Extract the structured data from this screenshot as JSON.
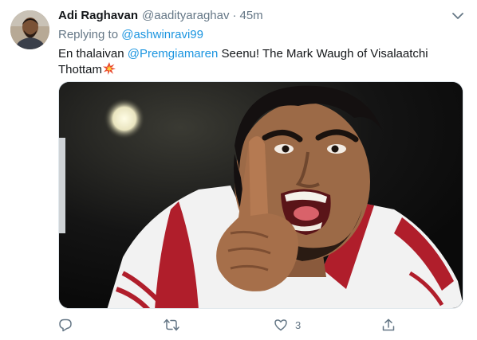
{
  "tweet": {
    "author_name": "Adi Raghavan",
    "author_handle": "@aadityaraghav",
    "separator": "·",
    "time": "45m",
    "replying_prefix": "Replying to ",
    "replying_handle": "@ashwinravi99",
    "text_part1": "En thalaivan ",
    "text_mention": "@Premgiamaren",
    "text_part2": " Seenu! The Mark Waugh of Visalaatchi Thottam",
    "emoji": "collision-emoji"
  },
  "actions": {
    "reply_count": "",
    "retweet_count": "",
    "like_count": "3",
    "share_count": ""
  },
  "colors": {
    "link": "#1b95e0",
    "secondary_text": "#657786",
    "primary_text": "#14171a",
    "border": "#e1e8ed"
  }
}
